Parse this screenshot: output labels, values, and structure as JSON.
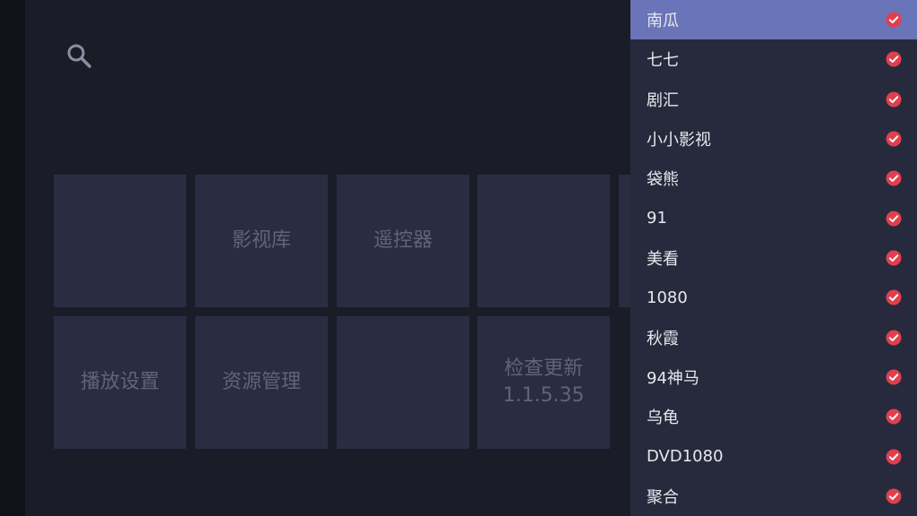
{
  "tiles": [
    {
      "label": ""
    },
    {
      "label": "影视库"
    },
    {
      "label": "遥控器"
    },
    {
      "label": ""
    },
    {
      "label": "播放设置"
    },
    {
      "label": "资源管理"
    },
    {
      "label": ""
    },
    {
      "label": "检查更新",
      "sub": "1.1.5.35"
    }
  ],
  "sources": [
    {
      "label": "南瓜",
      "active": true
    },
    {
      "label": "七七"
    },
    {
      "label": "剧汇"
    },
    {
      "label": "小小影视"
    },
    {
      "label": "袋熊"
    },
    {
      "label": "91"
    },
    {
      "label": "美看"
    },
    {
      "label": "1080"
    },
    {
      "label": "秋霞"
    },
    {
      "label": "94神马"
    },
    {
      "label": "乌龟"
    },
    {
      "label": "DVD1080"
    },
    {
      "label": "聚合"
    }
  ],
  "colors": {
    "accent": "#6a74b8",
    "check": "#e0404e",
    "tile": "#2a2d42"
  },
  "icons": {
    "search": "search-icon",
    "selected": "check-circle-icon"
  }
}
